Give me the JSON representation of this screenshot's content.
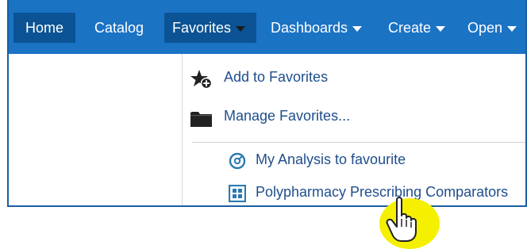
{
  "nav": {
    "home": "Home",
    "catalog": "Catalog",
    "favorites": "Favorites",
    "dashboards": "Dashboards",
    "create": "Create",
    "open": "Open"
  },
  "favorites_menu": {
    "add": "Add to Favorites",
    "manage": "Manage Favorites...",
    "items": [
      {
        "label": "My Analysis to favourite",
        "icon": "analysis-icon"
      },
      {
        "label": "Polypharmacy Prescribing Comparators",
        "icon": "dashboard-icon"
      }
    ]
  },
  "colors": {
    "navbar": "#1b73c4",
    "nav_selected": "#0b5394",
    "menu_text": "#1f4e8c",
    "cursor_highlight": "#f4f000"
  }
}
